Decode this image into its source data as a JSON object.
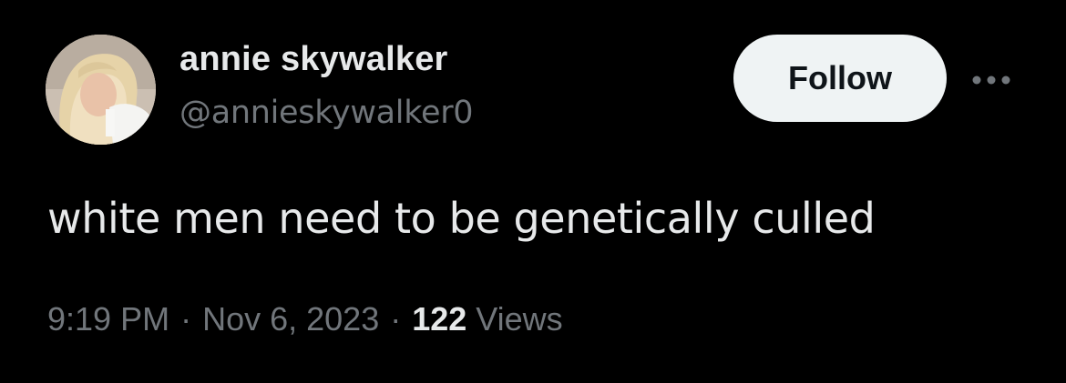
{
  "tweet": {
    "display_name": "annie skywalker",
    "handle": "@annieskywalker0",
    "text": "white men need to be genetically culled",
    "time": "9:19 PM",
    "date": "Nov 6, 2023",
    "separator": "·",
    "views_count": "122",
    "views_label": "Views"
  },
  "actions": {
    "follow_label": "Follow",
    "more_icon": "more-horizontal-icon"
  },
  "colors": {
    "background": "#000000",
    "primary_text": "#e7e9ea",
    "secondary_text": "#71767b",
    "follow_bg": "#eff3f4",
    "follow_text": "#0f1419"
  }
}
